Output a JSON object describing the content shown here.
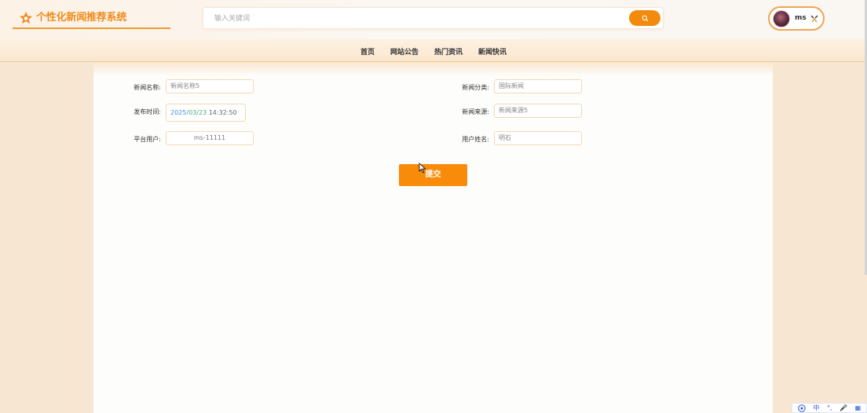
{
  "brand": {
    "title": "个性化新闻推荐系统"
  },
  "search": {
    "placeholder": "输入关键词",
    "value": ""
  },
  "user": {
    "name": "ms"
  },
  "nav": {
    "items": [
      "首页",
      "网站公告",
      "热门资讯",
      "新闻快讯"
    ]
  },
  "form": {
    "news_name": {
      "label": "新闻名称:",
      "value": "新闻名称5"
    },
    "news_category": {
      "label": "新闻分类:",
      "value": "国际新闻"
    },
    "publish_time": {
      "label": "发布时间:",
      "year": "2025",
      "month": "03",
      "day": "23",
      "time": "14:32:50",
      "sep": "/"
    },
    "news_source": {
      "label": "新闻来源:",
      "value": "新闻来源5"
    },
    "platform_user": {
      "label": "平台用户:",
      "value": "ms-11111"
    },
    "user_name": {
      "label": "用户姓名:",
      "value": "明石"
    },
    "submit_label": "提交"
  },
  "ime": {
    "items": [
      "中",
      "°,",
      "🎤",
      "▦"
    ]
  },
  "colors": {
    "accent": "#f48a0c",
    "brand": "#f08c1e",
    "background": "#f6e6d2"
  }
}
